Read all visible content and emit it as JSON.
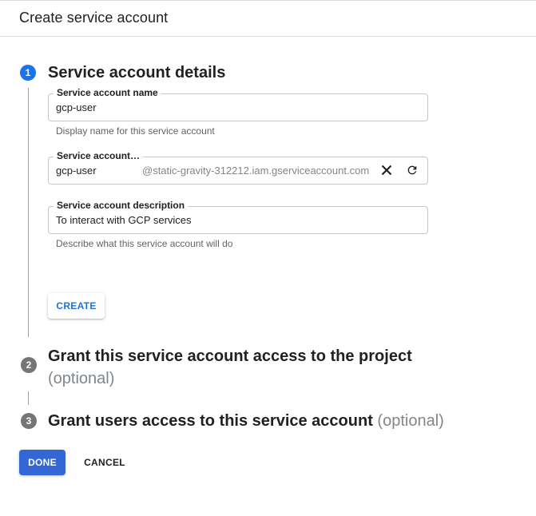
{
  "page": {
    "title": "Create service account"
  },
  "steps": [
    {
      "number": "1",
      "title": "Service account details"
    },
    {
      "number": "2",
      "title": "Grant this service account access to the project",
      "optional": "(optional)"
    },
    {
      "number": "3",
      "title": "Grant users access to this service account",
      "optional": "(optional)"
    }
  ],
  "form": {
    "name": {
      "label": "Service account name",
      "value": "gcp-user",
      "helper": "Display name for this service account"
    },
    "id": {
      "label": "Service account…",
      "value": "gcp-user",
      "suffix": "@static-gravity-312212.iam.gserviceaccount.com"
    },
    "description": {
      "label": "Service account description",
      "value": "To interact with GCP services",
      "helper": "Describe what this service account will do"
    }
  },
  "buttons": {
    "create": "CREATE",
    "done": "DONE",
    "cancel": "CANCEL"
  },
  "icons": {
    "clear": "close-icon",
    "regenerate": "refresh-icon"
  },
  "colors": {
    "accent": "#1a73e8",
    "done_bg": "#3367d6",
    "step_inactive": "#757575"
  }
}
